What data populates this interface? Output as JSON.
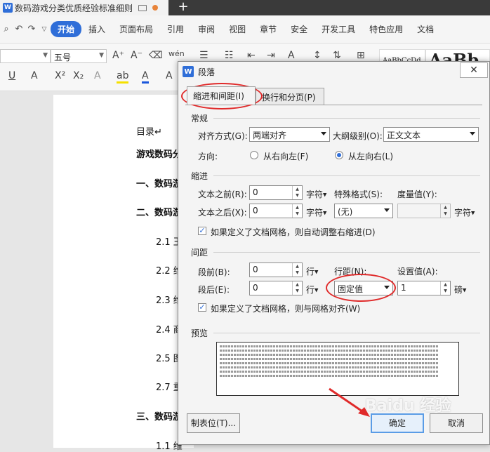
{
  "titlebar": {
    "doc_title": "数码游戏分类优质经验标准细则",
    "new_tab": "+"
  },
  "menubar": {
    "items": [
      "开始",
      "插入",
      "页面布局",
      "引用",
      "审阅",
      "视图",
      "章节",
      "安全",
      "开发工具",
      "特色应用",
      "文档"
    ],
    "active": "开始"
  },
  "ribbon": {
    "font_size": "五号",
    "style_sample_1": "AaBbCcDd",
    "style_sample_2": "AaBb"
  },
  "document": {
    "lines": [
      {
        "text": "目录↵",
        "bold": false
      },
      {
        "text": "游戏数码分",
        "bold": true
      },
      {
        "text": "一、数码游",
        "bold": true
      },
      {
        "text": "二、数码游",
        "bold": true
      },
      {
        "text": "2.1 王",
        "bold": false
      },
      {
        "text": "2.2 维",
        "bold": false
      },
      {
        "text": "2.3 维",
        "bold": false
      },
      {
        "text": "2.4 商",
        "bold": false
      },
      {
        "text": "2.5 图",
        "bold": false
      },
      {
        "text": "2.7 重",
        "bold": false
      },
      {
        "text": "三、数码游",
        "bold": true
      },
      {
        "text": "1.1 维",
        "bold": false
      }
    ]
  },
  "dialog": {
    "title": "段落",
    "tabs": [
      "缩进和间距(I)",
      "换行和分页(P)"
    ],
    "general": {
      "section": "常规",
      "alignment_label": "对齐方式(G):",
      "alignment_value": "两端对齐",
      "outline_label": "大纲级别(O):",
      "outline_value": "正文文本",
      "direction_label": "方向:",
      "direction_rtl": "从右向左(F)",
      "direction_ltr": "从左向右(L)"
    },
    "indent": {
      "section": "缩进",
      "before_label": "文本之前(R):",
      "before_value": "0",
      "before_unit": "字符",
      "after_label": "文本之后(X):",
      "after_value": "0",
      "after_unit": "字符",
      "special_label": "特殊格式(S):",
      "special_value": "(无)",
      "measure_label": "度量值(Y):",
      "measure_value": "",
      "measure_unit": "字符",
      "auto_adjust_label": "如果定义了文档网格，则自动调整右缩进(D)"
    },
    "spacing": {
      "section": "间距",
      "before_label": "段前(B):",
      "before_value": "0",
      "before_unit": "行",
      "after_label": "段后(E):",
      "after_value": "0",
      "after_unit": "行",
      "line_label": "行距(N):",
      "line_value": "固定值",
      "setting_label": "设置值(A):",
      "setting_value": "1",
      "setting_unit": "磅",
      "snap_grid_label": "如果定义了文档网格，则与网格对齐(W)"
    },
    "preview": {
      "section": "预览"
    },
    "buttons": {
      "tabs": "制表位(T)...",
      "ok": "确定",
      "cancel": "取消"
    }
  },
  "watermark": "Baidu 经验",
  "colors": {
    "accent": "#2f6ed8",
    "annotation": "#e02a2a"
  }
}
